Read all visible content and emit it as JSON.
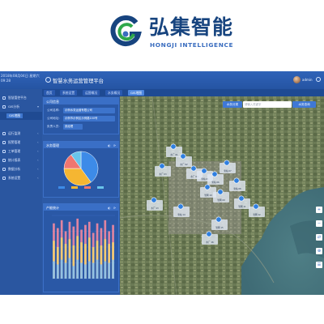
{
  "brand": {
    "name_cn": "弘集智能",
    "name_en": "HONGJI INTELLIGENCE",
    "colors": {
      "primary": "#17447f",
      "accent": "#3a6dbf",
      "green": "#2ea84a"
    }
  },
  "app": {
    "title": "智慧水务运营管理平台",
    "datetime_line1": "2018年08月04日 星期六",
    "datetime_line2": "09:28",
    "user": "admin",
    "colors": {
      "header": "#2554a3",
      "sidebar": "#2a56a0",
      "panel": "#2a58a6",
      "active": "#4d87e0"
    }
  },
  "tabs": [
    {
      "label": "首页",
      "active": false
    },
    {
      "label": "系统设置",
      "active": false
    },
    {
      "label": "运营概况",
      "active": false
    },
    {
      "label": "水务概况",
      "active": false
    },
    {
      "label": "GIS地图",
      "active": true
    }
  ],
  "sidebar": {
    "items": [
      {
        "label": "智慧管控平台",
        "icon": "home-icon",
        "active": false
      },
      {
        "label": "GIS分析",
        "icon": "map-pin-icon",
        "active": false
      },
      {
        "label": "GIS地图",
        "icon": "",
        "active": true,
        "sub": true
      },
      {
        "label": "运行监测",
        "icon": "monitor-icon",
        "active": false
      },
      {
        "label": "报警管理",
        "icon": "bell-icon",
        "active": false
      },
      {
        "label": "工单管理",
        "icon": "list-icon",
        "active": false
      },
      {
        "label": "统计报表",
        "icon": "chart-icon",
        "active": false
      },
      {
        "label": "数据分析",
        "icon": "analysis-icon",
        "active": false
      },
      {
        "label": "系统设置",
        "icon": "gear-icon",
        "active": false
      }
    ]
  },
  "company_panel": {
    "title": "公司信息",
    "rows": [
      {
        "label": "公司名称:",
        "value": "示例水务运营有限公司"
      },
      {
        "label": "公司地址:",
        "value": "示例市示例区示例路100号"
      },
      {
        "label": "负责人员:",
        "value": "张经理"
      }
    ]
  },
  "pie_panel": {
    "title": "水务管理",
    "tools": "◐ ⟳",
    "chart_data": {
      "type": "pie",
      "values": [
        40,
        35,
        15,
        10
      ],
      "colors": [
        "#3d8be8",
        "#f5b632",
        "#f0766f",
        "#69c4ea"
      ]
    }
  },
  "bar_panel": {
    "title": "产能统计",
    "tools": "◐ ⟳",
    "chart_data": {
      "type": "bar",
      "categories": [
        "1",
        "2",
        "3",
        "4",
        "5",
        "6",
        "7",
        "8",
        "9",
        "10",
        "11",
        "12",
        "13",
        "14",
        "15",
        "16"
      ],
      "series": [
        {
          "values": [
            3.5,
            3.2,
            3.7,
            3.0,
            3.6,
            3.3,
            3.8,
            3.1,
            3.4,
            3.6,
            2.9,
            3.5,
            3.2,
            3.7,
            3.0,
            3.4
          ],
          "color": "#f38aa0"
        },
        {
          "values": [
            2.4,
            2.0,
            2.6,
            2.2,
            2.5,
            2.1,
            2.7,
            2.3,
            2.2,
            2.6,
            2.0,
            2.4,
            2.1,
            2.5,
            2.2,
            2.3
          ],
          "color": "#f5d36e"
        },
        {
          "values": [
            1.1,
            0.9,
            1.2,
            1.0,
            1.3,
            0.8,
            1.2,
            1.0,
            0.9,
            1.1,
            1.0,
            1.2,
            0.9,
            1.1,
            1.0,
            1.2
          ],
          "color": "#88c0ef"
        }
      ],
      "ylim": [
        0,
        4
      ]
    }
  },
  "map": {
    "filter_label": "水务分类",
    "search_placeholder": "请输入关键字",
    "search_label": "水务查询",
    "tools": [
      "+",
      "−",
      "⇄",
      "⊕",
      "☰"
    ],
    "markers": [
      {
        "label": "水厂 01"
      },
      {
        "label": "水厂 02"
      },
      {
        "label": "水厂 03"
      },
      {
        "label": "水厂 04"
      },
      {
        "label": "泵站 05"
      },
      {
        "label": "泵站 06"
      },
      {
        "label": "泵站 07"
      },
      {
        "label": "泵站 08"
      },
      {
        "label": "管网 09"
      },
      {
        "label": "管网 10"
      },
      {
        "label": "管网 11"
      },
      {
        "label": "管网 12"
      },
      {
        "label": "水厂 13"
      },
      {
        "label": "泵站 14"
      },
      {
        "label": "管网 15"
      },
      {
        "label": "水厂 16"
      }
    ]
  }
}
